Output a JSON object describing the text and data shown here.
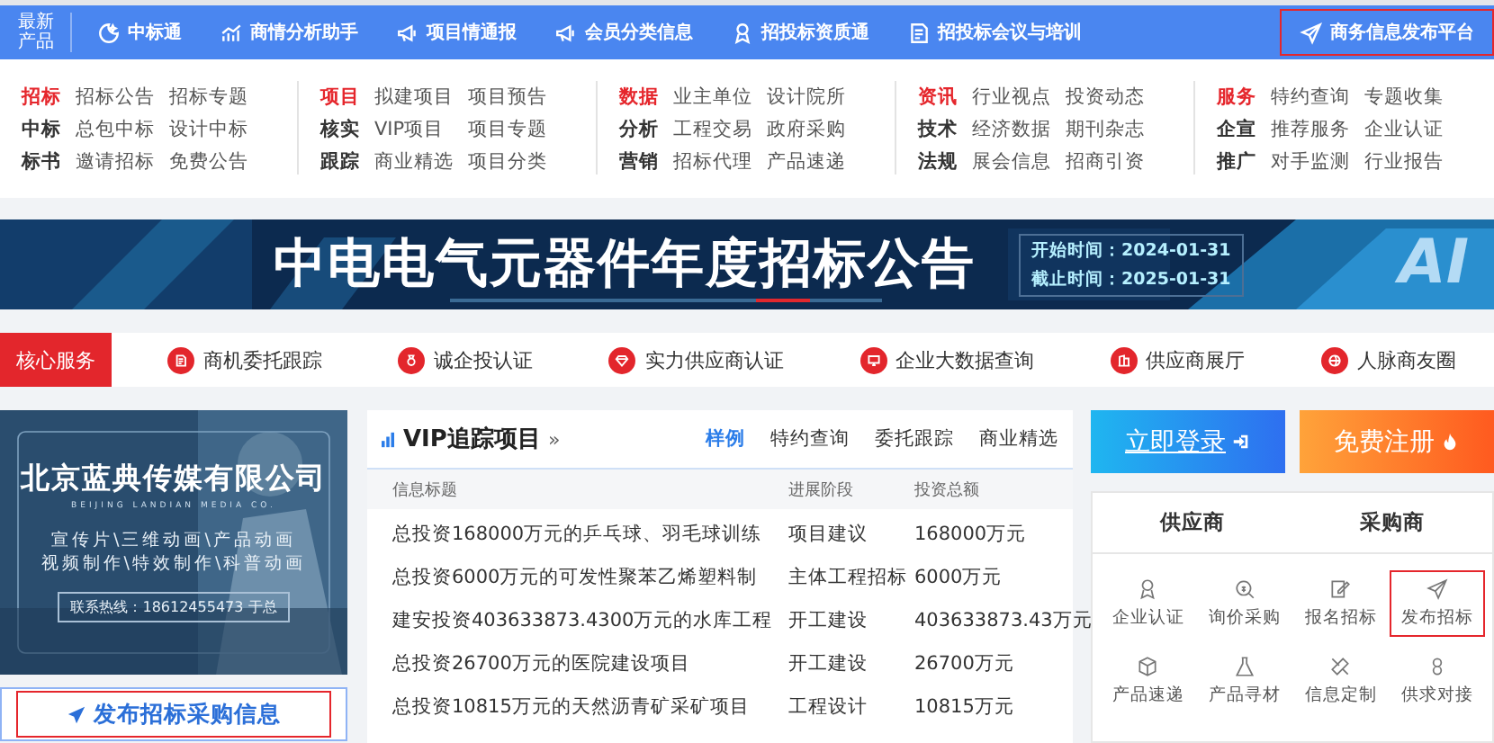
{
  "top_nav": {
    "label": "最新产品",
    "items": [
      {
        "label": "中标通",
        "highlighted": false
      },
      {
        "label": "商情分析助手",
        "highlighted": false
      },
      {
        "label": "项目情通报",
        "highlighted": false
      },
      {
        "label": "会员分类信息",
        "highlighted": false
      },
      {
        "label": "招投标资质通",
        "highlighted": false
      },
      {
        "label": "招投标会议与培训",
        "highlighted": false
      },
      {
        "label": "商务信息发布平台",
        "highlighted": true
      }
    ]
  },
  "menu_groups": [
    {
      "rows": [
        {
          "label": "招标",
          "links": [
            "招标公告",
            "招标专题"
          ]
        },
        {
          "label": "中标",
          "links": [
            "总包中标",
            "设计中标"
          ]
        },
        {
          "label": "标书",
          "links": [
            "邀请招标",
            "免费公告"
          ]
        }
      ]
    },
    {
      "rows": [
        {
          "label": "项目",
          "links": [
            "拟建项目",
            "项目预告"
          ]
        },
        {
          "label": "核实",
          "links": [
            "VIP项目",
            "项目专题"
          ]
        },
        {
          "label": "跟踪",
          "links": [
            "商业精选",
            "项目分类"
          ]
        }
      ]
    },
    {
      "rows": [
        {
          "label": "数据",
          "links": [
            "业主单位",
            "设计院所"
          ]
        },
        {
          "label": "分析",
          "links": [
            "工程交易",
            "政府采购"
          ]
        },
        {
          "label": "营销",
          "links": [
            "招标代理",
            "产品速递"
          ]
        }
      ]
    },
    {
      "rows": [
        {
          "label": "资讯",
          "links": [
            "行业视点",
            "投资动态"
          ]
        },
        {
          "label": "技术",
          "links": [
            "经济数据",
            "期刊杂志"
          ]
        },
        {
          "label": "法规",
          "links": [
            "展会信息",
            "招商引资"
          ]
        }
      ]
    },
    {
      "rows": [
        {
          "label": "服务",
          "links": [
            "特约查询",
            "专题收集"
          ]
        },
        {
          "label": "企宣",
          "links": [
            "推荐服务",
            "企业认证"
          ]
        },
        {
          "label": "推广",
          "links": [
            "对手监测",
            "行业报告"
          ]
        }
      ]
    }
  ],
  "banner": {
    "title": "中电电气元器件年度招标公告",
    "start": "开始时间：2024-01-31",
    "end": "截止时间：2025-01-31",
    "badge": "AI"
  },
  "core_services": {
    "label": "核心服务",
    "items": [
      "商机委托跟踪",
      "诚企投认证",
      "实力供应商认证",
      "企业大数据查询",
      "供应商展厅",
      "人脉商友圈"
    ]
  },
  "ad": {
    "title": "北京蓝典传媒有限公司",
    "subtitle": "BEIJING LANDIAN MEDIA CO.",
    "line_1": "宣传片\\三维动画\\产品动画",
    "line_2": "视频制作\\特效制作\\科普动画",
    "hotline": "联系热线：18612455473 于总"
  },
  "publish_button": {
    "label": "发布招标采购信息",
    "highlighted": true
  },
  "vip": {
    "title": "VIP追踪项目",
    "more": "»",
    "tabs": [
      {
        "label": "样例",
        "selected": true
      },
      {
        "label": "特约查询",
        "selected": false
      },
      {
        "label": "委托跟踪",
        "selected": false
      },
      {
        "label": "商业精选",
        "selected": false
      }
    ],
    "table": {
      "columns": [
        "信息标题",
        "进展阶段",
        "投资总额"
      ],
      "rows": [
        [
          "总投资168000万元的乒乓球、羽毛球训练",
          "项目建议",
          "168000万元"
        ],
        [
          "总投资6000万元的可发性聚苯乙烯塑料制",
          "主体工程招标",
          "6000万元"
        ],
        [
          "建安投资403633873.4300万元的水库工程",
          "开工建设",
          "403633873.43万元"
        ],
        [
          "总投资26700万元的医院建设项目",
          "开工建设",
          "26700万元"
        ],
        [
          "总投资10815万元的天然沥青矿采矿项目",
          "工程设计",
          "10815万元"
        ]
      ]
    }
  },
  "login_button": {
    "label": "立即登录"
  },
  "register_button": {
    "label": "免费注册"
  },
  "role_tabs": [
    {
      "label": "供应商",
      "selected": false
    },
    {
      "label": "采购商",
      "selected": false
    }
  ],
  "quick_links": [
    {
      "label": "企业认证",
      "highlighted": false
    },
    {
      "label": "询价采购",
      "highlighted": false
    },
    {
      "label": "报名招标",
      "highlighted": false
    },
    {
      "label": "发布招标",
      "highlighted": true
    },
    {
      "label": "产品速递",
      "highlighted": false
    },
    {
      "label": "产品寻材",
      "highlighted": false
    },
    {
      "label": "信息定制",
      "highlighted": false
    },
    {
      "label": "供求对接",
      "highlighted": false
    }
  ]
}
